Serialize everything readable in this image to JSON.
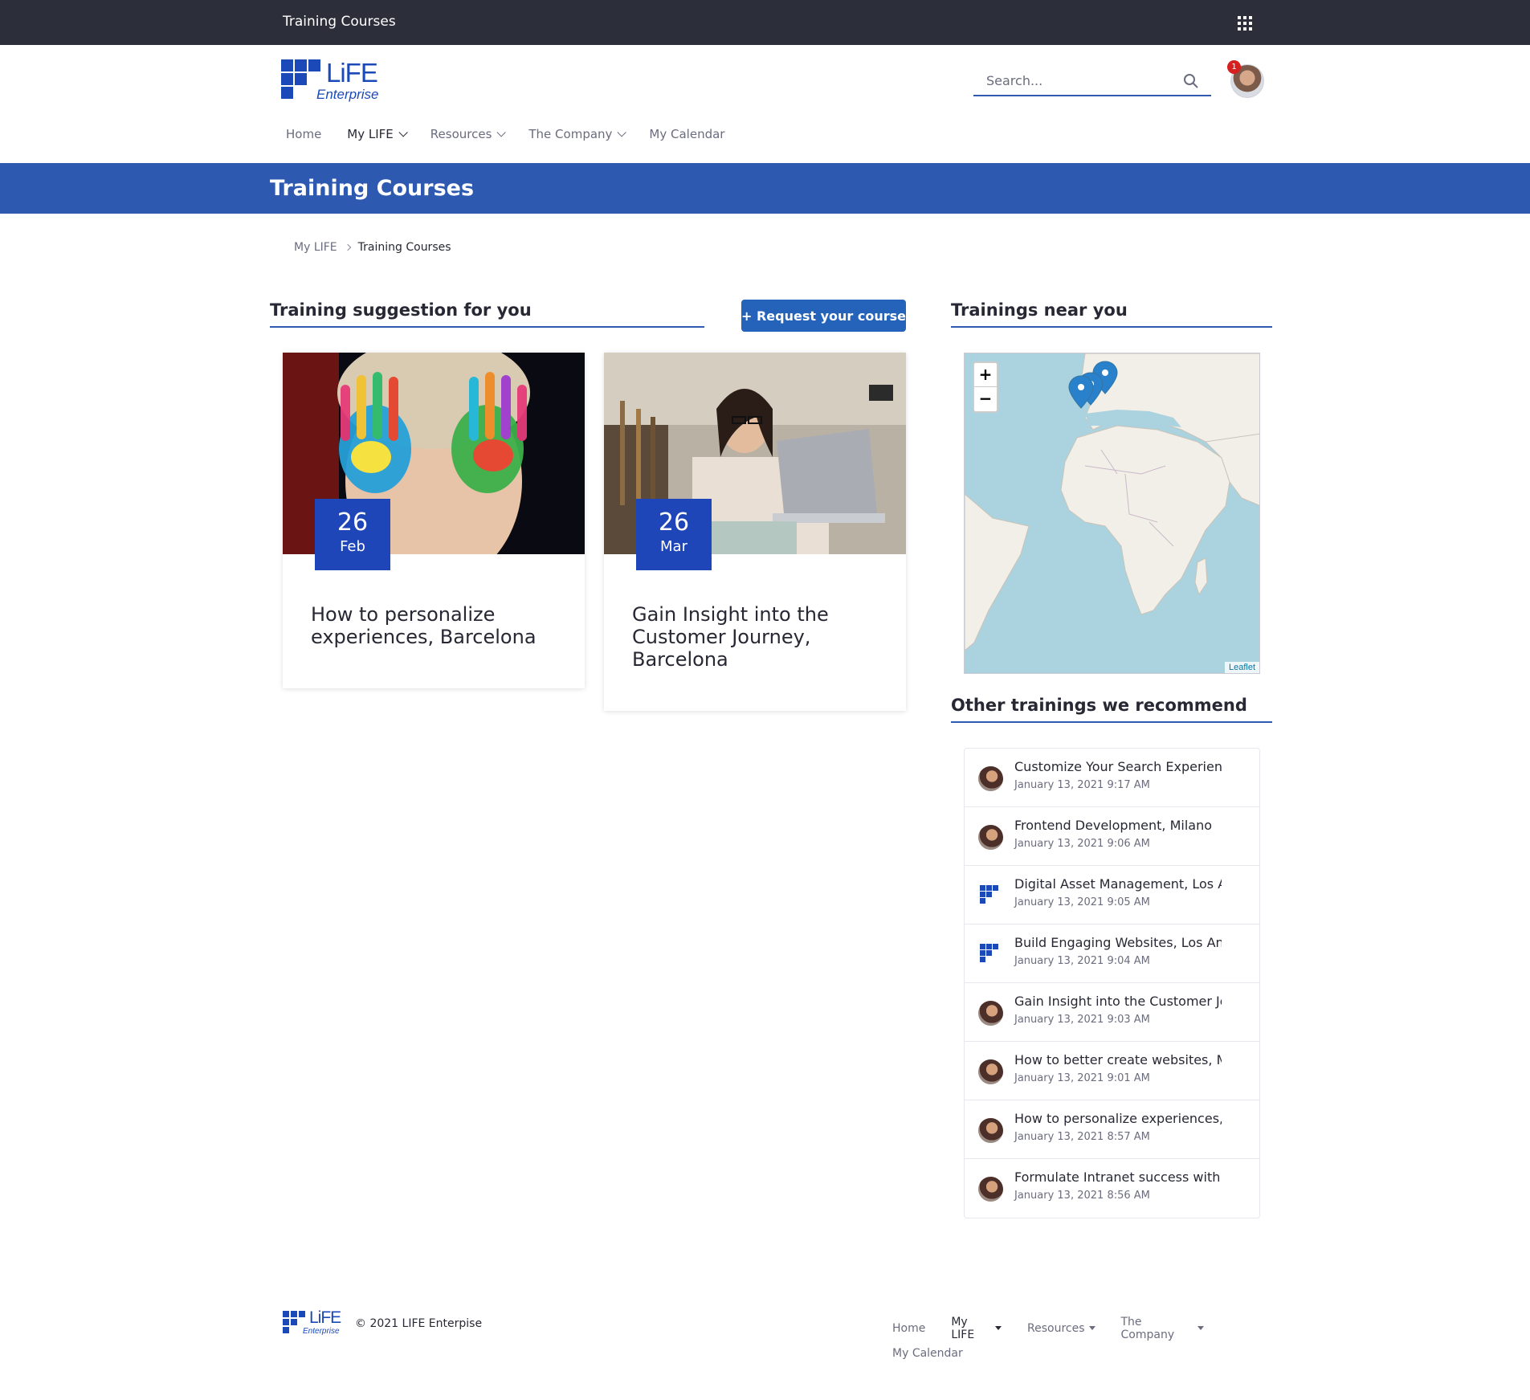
{
  "topbar": {
    "title": "Training Courses"
  },
  "header": {
    "logo": {
      "brand": "LiFE",
      "sub": "Enterprise"
    },
    "search": {
      "placeholder": "Search..."
    },
    "notification_count": "1"
  },
  "nav": {
    "items": [
      {
        "label": "Home",
        "dropdown": false,
        "active": false
      },
      {
        "label": "My LIFE",
        "dropdown": true,
        "active": true
      },
      {
        "label": "Resources",
        "dropdown": true,
        "active": false
      },
      {
        "label": "The Company",
        "dropdown": true,
        "active": false
      },
      {
        "label": "My Calendar",
        "dropdown": false,
        "active": false
      }
    ]
  },
  "banner": {
    "title": "Training Courses"
  },
  "breadcrumb": {
    "parent": "My LIFE",
    "current": "Training Courses"
  },
  "suggestions": {
    "heading": "Training suggestion for you",
    "request_button": "+ Request your course",
    "cards": [
      {
        "day": "26",
        "month": "Feb",
        "title": "How to personalize experiences, Barcelona"
      },
      {
        "day": "26",
        "month": "Mar",
        "title": "Gain Insight into the Customer Journey, Barcelona"
      }
    ]
  },
  "near": {
    "heading": "Trainings near you",
    "zoom_in": "+",
    "zoom_out": "−",
    "attribution": "Leaflet"
  },
  "other": {
    "heading": "Other trainings we recommend",
    "items": [
      {
        "title": "Customize Your Search Experience, ",
        "date": "January 13, 2021 9:17 AM",
        "icon": "user-photo"
      },
      {
        "title": "Frontend Development, Milano",
        "date": "January 13, 2021 9:06 AM",
        "icon": "user-photo"
      },
      {
        "title": "Digital Asset Management, Los Angeles",
        "date": "January 13, 2021 9:05 AM",
        "icon": "life-logo"
      },
      {
        "title": "Build Engaging Websites, Los Angeles",
        "date": "January 13, 2021 9:04 AM",
        "icon": "life-logo"
      },
      {
        "title": "Gain Insight into the Customer Journey",
        "date": "January 13, 2021 9:03 AM",
        "icon": "user-photo"
      },
      {
        "title": "How to better create websites, Milano",
        "date": "January 13, 2021 9:01 AM",
        "icon": "user-photo"
      },
      {
        "title": "How to personalize experiences, Barcelona",
        "date": "January 13, 2021 8:57 AM",
        "icon": "user-photo"
      },
      {
        "title": "Formulate Intranet success with Insights",
        "date": "January 13, 2021 8:56 AM",
        "icon": "user-photo"
      }
    ]
  },
  "footer": {
    "logo": {
      "brand": "LiFE",
      "sub": "Enterprise"
    },
    "copyright": "© 2021 LIFE Enterpise",
    "nav": [
      {
        "label": "Home",
        "dropdown": false
      },
      {
        "label": "My LIFE",
        "dropdown": true
      },
      {
        "label": "Resources",
        "dropdown": true
      },
      {
        "label": "The Company",
        "dropdown": true
      },
      {
        "label": "My Calendar",
        "dropdown": false
      }
    ]
  },
  "colors": {
    "topbar": "#2c2e3a",
    "banner": "#2d5ab0",
    "brand": "#1b49b8",
    "button": "#2463b9",
    "date_badge": "#1f46b8"
  }
}
